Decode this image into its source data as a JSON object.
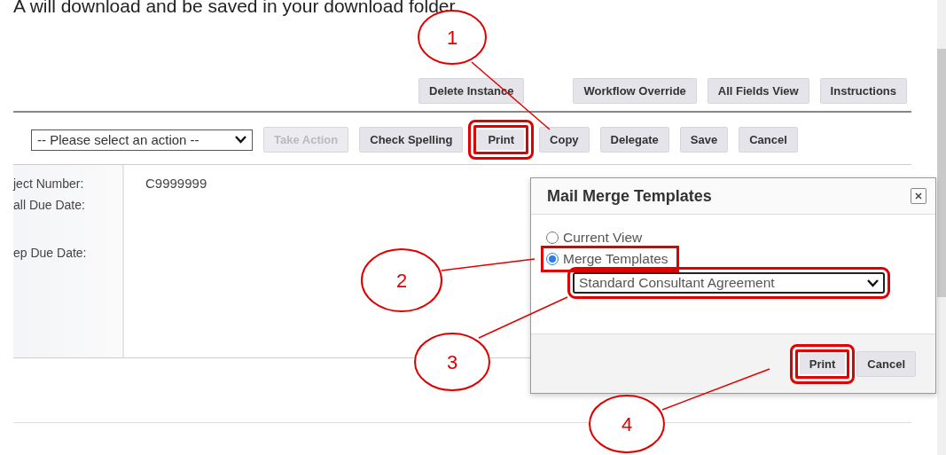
{
  "intro_text": "A will download and be saved in your download folder.",
  "top_buttons": [
    {
      "label": "Delete Instance"
    },
    {
      "label": "Workflow Override"
    },
    {
      "label": "All Fields View"
    },
    {
      "label": "Instructions"
    }
  ],
  "action_bar": {
    "action_select": {
      "value": "-- Please select an action --"
    },
    "buttons": [
      {
        "label": "Take Action",
        "disabled": true,
        "highlighted": false
      },
      {
        "label": "Check Spelling",
        "disabled": false,
        "highlighted": false
      },
      {
        "label": "Print",
        "disabled": false,
        "highlighted": true
      },
      {
        "label": "Copy",
        "disabled": false,
        "highlighted": false
      },
      {
        "label": "Delegate",
        "disabled": false,
        "highlighted": false
      },
      {
        "label": "Save",
        "disabled": false,
        "highlighted": false
      },
      {
        "label": "Cancel",
        "disabled": false,
        "highlighted": false
      }
    ]
  },
  "fields": [
    {
      "label": "ject Number:",
      "value": "C9999999"
    },
    {
      "label": "all Due Date:"
    },
    {
      "label": "ep Due Date:"
    }
  ],
  "dialog": {
    "title": "Mail Merge Templates",
    "options": [
      {
        "label": "Current View",
        "selected": false,
        "highlighted": false
      },
      {
        "label": "Merge Templates",
        "selected": true,
        "highlighted": true
      }
    ],
    "template_select": {
      "value": "Standard Consultant Agreement",
      "highlighted": true
    },
    "buttons": [
      {
        "label": "Print",
        "highlighted": true
      },
      {
        "label": "Cancel",
        "highlighted": false
      }
    ]
  },
  "callouts": [
    {
      "label": "1"
    },
    {
      "label": "2"
    },
    {
      "label": "3"
    },
    {
      "label": "4"
    }
  ]
}
